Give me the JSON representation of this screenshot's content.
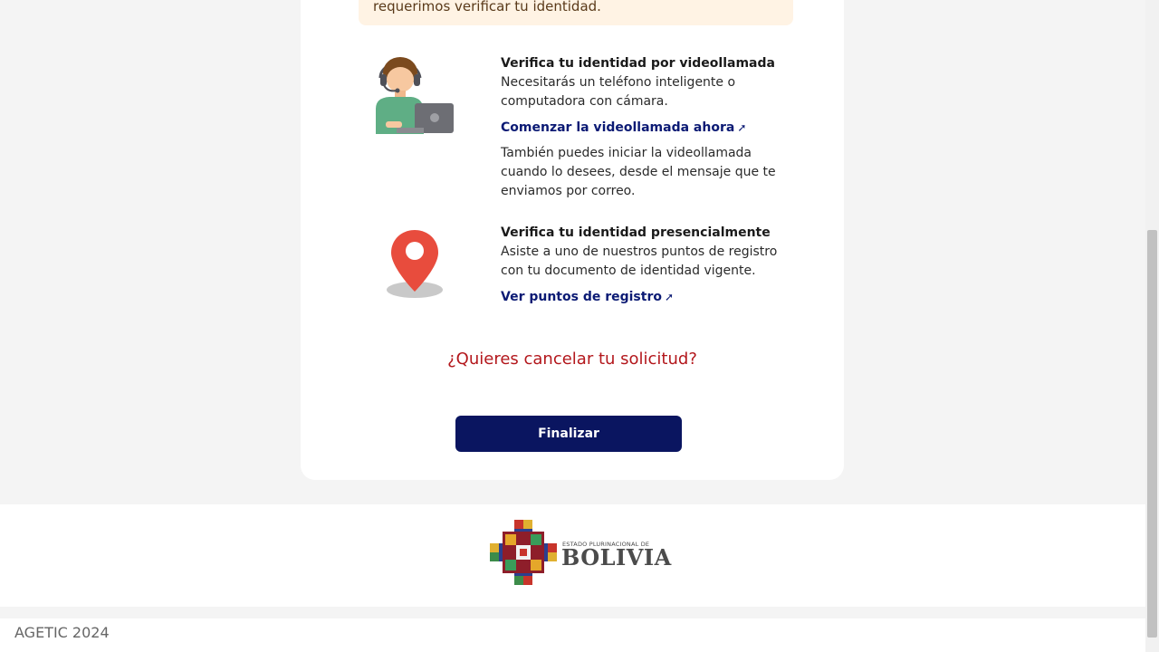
{
  "alert": {
    "text": "requerimos verificar tu identidad."
  },
  "video_option": {
    "title": "Verifica tu identidad por videollamada",
    "description": "Necesitarás un teléfono inteligente o computadora con cámara.",
    "link": "Comenzar la videollamada ahora",
    "link_icon": "external-link-icon",
    "extra": "También puedes iniciar la videollamada cuando lo desees, desde el mensaje que te enviamos por correo."
  },
  "presencial_option": {
    "title": "Verifica tu identidad presencialmente",
    "description": "Asiste a uno de nuestros puntos de registro con tu documento de identidad vigente.",
    "link": "Ver puntos de registro",
    "link_icon": "external-link-icon"
  },
  "cancel_link": "¿Quieres cancelar tu solicitud?",
  "finish_button": "Finalizar",
  "footer": {
    "logo_small": "ESTADO PLURINACIONAL DE",
    "logo_big": "BOLIVIA",
    "copyright": "AGETIC 2024"
  },
  "colors": {
    "primary": "#0a1560",
    "link": "#0b1a74",
    "danger": "#b3171c",
    "alert_bg": "#fff3e4",
    "pin": "#e84c3d"
  }
}
